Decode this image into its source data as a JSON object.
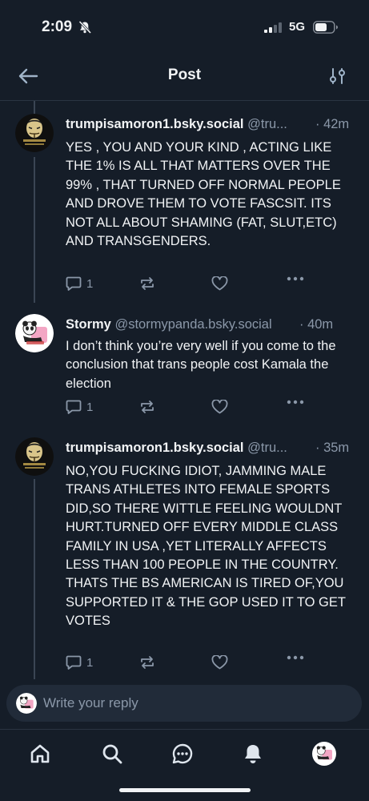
{
  "status_bar": {
    "time": "2:09",
    "network": "5G"
  },
  "header": {
    "title": "Post"
  },
  "posts": [
    {
      "display_name": "trumpisamoron1.bsky.social",
      "handle": "@tru...",
      "time": "· 42m",
      "avatar_text": "IN CASE OF REVOLUTION BREAK GLASS",
      "text": "YES , YOU AND YOUR KIND , ACTING LIKE THE 1% IS ALL THAT MATTERS OVER THE 99% , THAT TURNED OFF NORMAL PEOPLE AND DROVE THEM TO VOTE FASCSIT.  ITS NOT ALL ABOUT SHAMING (FAT, SLUT,ETC) AND TRANSGENDERS.",
      "reply_count": "1"
    },
    {
      "display_name": "Stormy",
      "handle": "@stormypanda.bsky.social",
      "time": "· 40m",
      "text": "I don’t think you’re very well if you come to the conclusion that trans people cost Kamala the election",
      "reply_count": "1"
    },
    {
      "display_name": "trumpisamoron1.bsky.social",
      "handle": "@tru...",
      "time": "· 35m",
      "avatar_text": "IN CASE OF REVOLUTION BREAK GLASS",
      "text": "NO,YOU FUCKING IDIOT, JAMMING MALE TRANS ATHLETES INTO FEMALE SPORTS DID,SO THERE WITTLE FEELING WOULDNT HURT.TURNED OFF EVERY MIDDLE CLASS FAMILY IN USA ,YET LITERALLY AFFECTS LESS THAN 100 PEOPLE IN THE COUNTRY. THATS THE BS  AMERICAN IS TIRED OF,YOU SUPPORTED IT & THE GOP USED IT TO GET  VOTES",
      "reply_count": "1"
    }
  ],
  "composer": {
    "placeholder": "Write your reply"
  },
  "tabs": [
    "home",
    "search",
    "chat",
    "notifications",
    "profile"
  ],
  "icons": {
    "back": "arrow-left-icon",
    "filter": "sliders-icon",
    "reply": "reply-bubble-icon",
    "repost": "repost-icon",
    "like": "heart-icon",
    "more": "ellipsis-icon"
  },
  "colors": {
    "background": "#151d28",
    "muted": "#8b98a9",
    "composer_bg": "#212b39",
    "thread_line": "#3a4554"
  }
}
